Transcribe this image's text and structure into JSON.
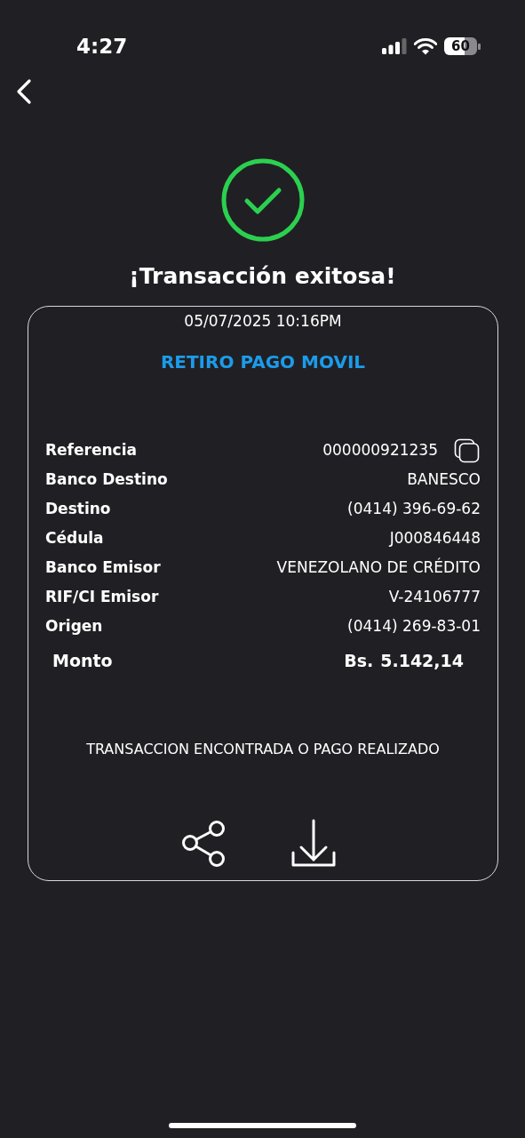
{
  "status_bar": {
    "time": "4:27",
    "battery": "60"
  },
  "title": "¡Transacción exitosa!",
  "receipt": {
    "datetime": "05/07/2025 10:16PM",
    "operation": "RETIRO PAGO MOVIL",
    "details": [
      {
        "label": "Referencia",
        "value": "000000921235",
        "copyable": true
      },
      {
        "label": "Banco Destino",
        "value": "BANESCO",
        "copyable": false
      },
      {
        "label": "Destino",
        "value": "(0414) 396-69-62",
        "copyable": false
      },
      {
        "label": "Cédula",
        "value": "J000846448",
        "copyable": false
      },
      {
        "label": "Banco Emisor",
        "value": "VENEZOLANO DE CRÉDITO",
        "copyable": false
      },
      {
        "label": "RIF/CI Emisor",
        "value": "V-24106777",
        "copyable": false
      },
      {
        "label": "Origen",
        "value": "(0414) 269-83-01",
        "copyable": false
      }
    ],
    "amount": {
      "label": "Monto",
      "currency": "Bs.",
      "value": "5.142,14"
    },
    "message": "TRANSACCION ENCONTRADA O PAGO REALIZADO",
    "actions": [
      {
        "kind": "share"
      },
      {
        "kind": "download"
      }
    ]
  }
}
